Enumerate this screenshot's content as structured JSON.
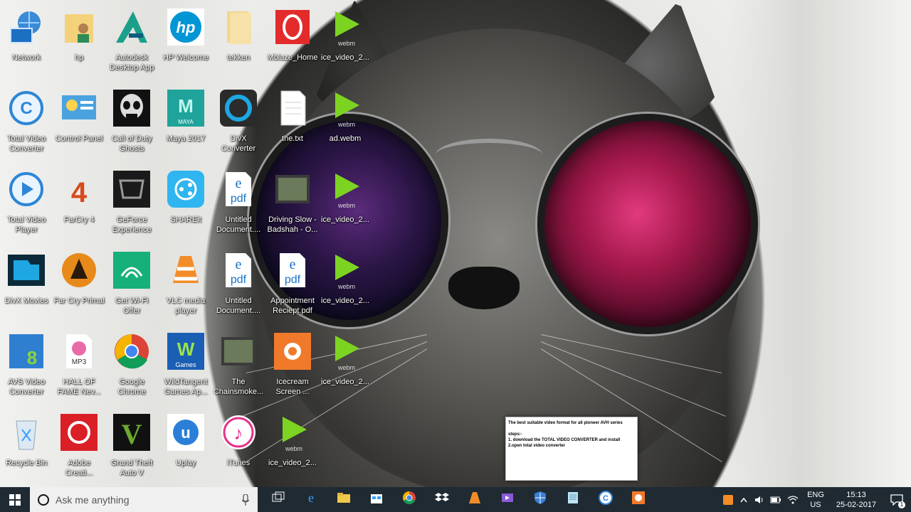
{
  "desktop": {
    "icons": [
      {
        "label": "Network",
        "icon": "network-icon"
      },
      {
        "label": "hp",
        "icon": "user-folder-icon"
      },
      {
        "label": "Autodesk\nDesktop App",
        "icon": "autodesk-icon"
      },
      {
        "label": "HP Welcome",
        "icon": "hp-icon"
      },
      {
        "label": "tekken",
        "icon": "folder-icon"
      },
      {
        "label": "Mblaze_Home",
        "icon": "mblaze-icon"
      },
      {
        "label": "ice_video_2...",
        "icon": "webm-file-icon"
      },
      {
        "label": "Total Video\nConverter",
        "icon": "total-video-converter-icon"
      },
      {
        "label": "Control Panel",
        "icon": "control-panel-icon"
      },
      {
        "label": "Call of Duty\nGhosts",
        "icon": "call-of-duty-icon"
      },
      {
        "label": "Maya 2017",
        "icon": "maya-icon"
      },
      {
        "label": "DivX\nConverter",
        "icon": "divx-converter-icon"
      },
      {
        "label": "the.txt",
        "icon": "text-file-icon"
      },
      {
        "label": "ad.webm",
        "icon": "webm-file-icon"
      },
      {
        "label": "Total Video\nPlayer",
        "icon": "total-video-player-icon"
      },
      {
        "label": "FarCry 4",
        "icon": "farcry4-icon"
      },
      {
        "label": "GeForce\nExperience",
        "icon": "geforce-icon"
      },
      {
        "label": "SHAREit",
        "icon": "shareit-icon"
      },
      {
        "label": "Untitled\nDocument....",
        "icon": "pdf-file-icon"
      },
      {
        "label": "Driving Slow -\nBadshah - O...",
        "icon": "video-file-icon"
      },
      {
        "label": "ice_video_2...",
        "icon": "webm-file-icon"
      },
      {
        "label": "DivX Movies",
        "icon": "divx-movies-icon"
      },
      {
        "label": "Far Cry Primal",
        "icon": "farcry-primal-icon"
      },
      {
        "label": "Get Wi-Fi\nOffer",
        "icon": "wifi-offer-icon"
      },
      {
        "label": "VLC media\nplayer",
        "icon": "vlc-icon"
      },
      {
        "label": "Untitled\nDocument....",
        "icon": "pdf-file-icon"
      },
      {
        "label": "Appointment\nReciept.pdf",
        "icon": "pdf-file-icon"
      },
      {
        "label": "ice_video_2...",
        "icon": "webm-file-icon"
      },
      {
        "label": "AVS Video\nConverter",
        "icon": "avs-icon"
      },
      {
        "label": "HALL OF\nFAME Nev...",
        "icon": "mp3-file-icon"
      },
      {
        "label": "Google\nChrome",
        "icon": "chrome-icon"
      },
      {
        "label": "WildTangent\nGames Ap...",
        "icon": "wildtangent-icon"
      },
      {
        "label": "The\nChainsmoke...",
        "icon": "video-file-icon"
      },
      {
        "label": "Icecream\nScreen ...",
        "icon": "icecream-icon"
      },
      {
        "label": "ice_video_2...",
        "icon": "webm-file-icon"
      },
      {
        "label": "Recycle Bin",
        "icon": "recycle-bin-icon"
      },
      {
        "label": "Adobe\nCreati...",
        "icon": "adobe-cc-icon"
      },
      {
        "label": "Grand Theft\nAuto V",
        "icon": "gta-icon"
      },
      {
        "label": "Uplay",
        "icon": "uplay-icon"
      },
      {
        "label": "iTunes",
        "icon": "itunes-icon"
      },
      {
        "label": "ice_video_2...",
        "icon": "webm-file-icon"
      }
    ]
  },
  "notepad": {
    "line1": "The best suitable video format for all pioneer AVH series",
    "line2": "steps:-",
    "line3": "1. download the TOTAL VIDEO CONVERTER and install",
    "line4": "2.open total video converter"
  },
  "taskbar": {
    "search_placeholder": "Ask me anything",
    "apps": [
      "task-view-icon",
      "edge-icon",
      "file-explorer-icon",
      "store-icon",
      "chrome-icon",
      "dropbox-icon",
      "vlc-icon",
      "video-editor-icon",
      "defender-icon",
      "notepad-icon",
      "total-video-converter-icon",
      "icecream-icon"
    ],
    "language": "ENG",
    "region": "US",
    "time": "15:13",
    "date": "25-02-2017",
    "notification_count": "1"
  },
  "colors": {
    "taskbar": "#1f2a33",
    "search_bg": "#f0f0f0",
    "accent": "#3aa0ff"
  }
}
